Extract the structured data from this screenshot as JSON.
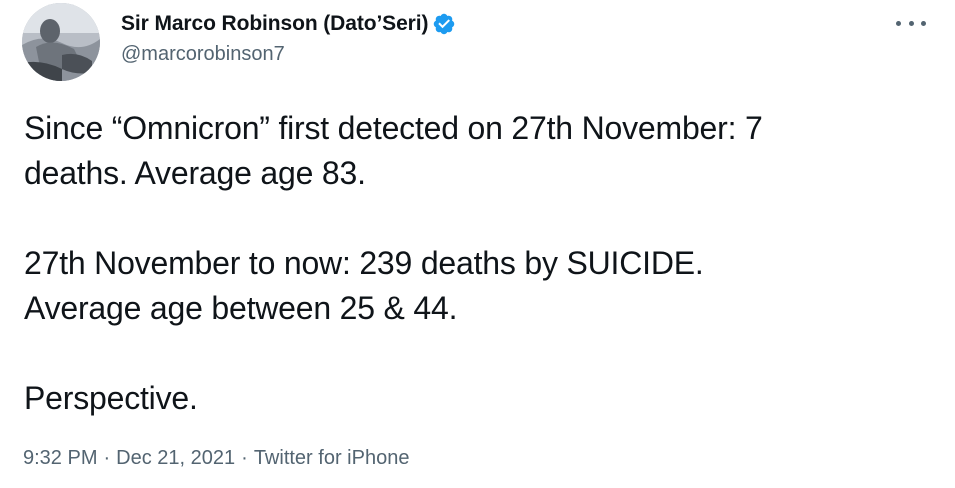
{
  "author": {
    "display_name": "Sir Marco Robinson (Dato’Seri)",
    "handle": "@marcorobinson7",
    "verified_icon": "verified-badge-icon",
    "avatar_icon": "profile-photo"
  },
  "menu": {
    "icon": "more-options-icon"
  },
  "tweet": {
    "paragraphs": [
      "Since “Omnicron” first detected on 27th November: 7\ndeaths. Average age 83.",
      "27th November to now: 239 deaths by SUICIDE.\nAverage age between 25 & 44.",
      "Perspective."
    ]
  },
  "meta": {
    "time": "9:32 PM",
    "date": "Dec 21, 2021",
    "source": "Twitter for iPhone",
    "separator": "·"
  },
  "colors": {
    "text": "#0f1419",
    "secondary": "#536471",
    "verified": "#1d9bf0"
  }
}
